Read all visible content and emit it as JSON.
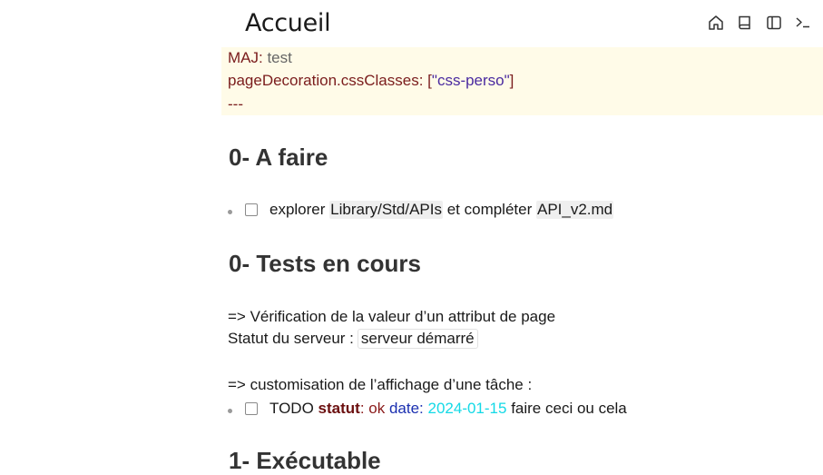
{
  "page": {
    "title": "Accueil"
  },
  "toolbar": {
    "icons": [
      "home-icon",
      "book-icon",
      "sidebar-icon",
      "terminal-icon"
    ]
  },
  "frontmatter": {
    "line1_key": "MAJ",
    "line1_sep": ": ",
    "line1_value": "test",
    "line2_key": "pageDecoration.cssClasses",
    "line2_sep": ": ",
    "line2_open": "[",
    "line2_value": "\"css-perso\"",
    "line2_close": "]",
    "line3": "---"
  },
  "sections": {
    "todo_heading": "0- A faire",
    "todo_task": {
      "prefix": "explorer ",
      "link1": "Library/Std/APIs",
      "middle": " et compléter ",
      "link2": "API_v2.md"
    },
    "tests_heading": "0- Tests en cours",
    "verif_line": "=> Vérification de la valeur d’un attribut de page",
    "server_label": "Statut du serveur :",
    "server_value": "serveur démarré",
    "custom_line": "=> customisation de l’affichage d’une tâche :",
    "custom_task": {
      "todo": "TODO ",
      "statut_key": "statut",
      "statut_sep": ": ",
      "statut_val": "ok",
      "date_key": " date",
      "date_sep": ": ",
      "date_val": "2024-01-15",
      "rest": " faire ceci ou cela"
    },
    "exec_heading": "1- Exécutable"
  },
  "colors": {
    "frontmatter_bg": "#fffbe8",
    "key": "#7a1c1c",
    "string": "#4a2aa0",
    "date_value": "#14d9e6",
    "date_key": "#1a2fb0"
  }
}
